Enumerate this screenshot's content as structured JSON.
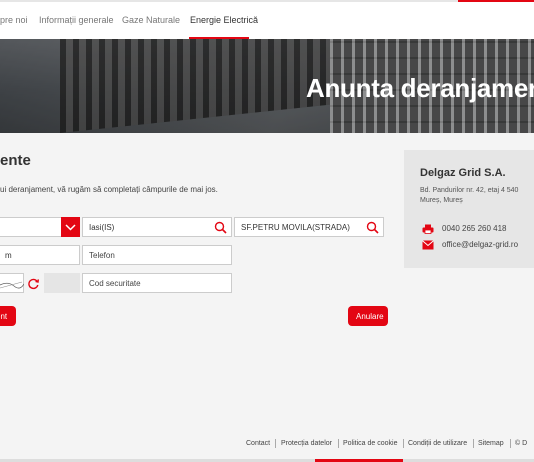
{
  "nav": {
    "items": [
      {
        "label": "pre noi"
      },
      {
        "label": "Informații generale"
      },
      {
        "label": "Gaze Naturale"
      },
      {
        "label": "Energie Electrică"
      }
    ]
  },
  "hero": {
    "title": "Anunta deranjament"
  },
  "form": {
    "title": "ente",
    "intro": "ui deranjament, vă rugăm să completați câmpurile de mai jos.",
    "locality": "Iasi(IS)",
    "street": "SF.PETRU MOVILA(STRADA)",
    "name_tail": "m",
    "phone_placeholder": "Telefon",
    "captcha_placeholder": "Cod securitate",
    "send_label": "ent",
    "cancel_label": "Anulare"
  },
  "contact": {
    "company": "Delgaz Grid S.A.",
    "address_line1": "Bd. Pandurilor nr. 42, etaj 4 540",
    "address_line2": "Mureș, Mureș",
    "phone": "0040 265 260 418",
    "email": "office@delgaz-grid.ro"
  },
  "footer": {
    "links": [
      "Contact",
      "Protecția datelor",
      "Politica de cookie",
      "Condiții de utilizare",
      "Sitemap",
      "© D"
    ]
  },
  "colors": {
    "accent": "#e30613",
    "panel": "#e6e6e6",
    "background": "#f4f4f4"
  },
  "icons": [
    "chevron-down-icon",
    "search-icon",
    "refresh-icon",
    "fax-icon",
    "mail-icon"
  ]
}
